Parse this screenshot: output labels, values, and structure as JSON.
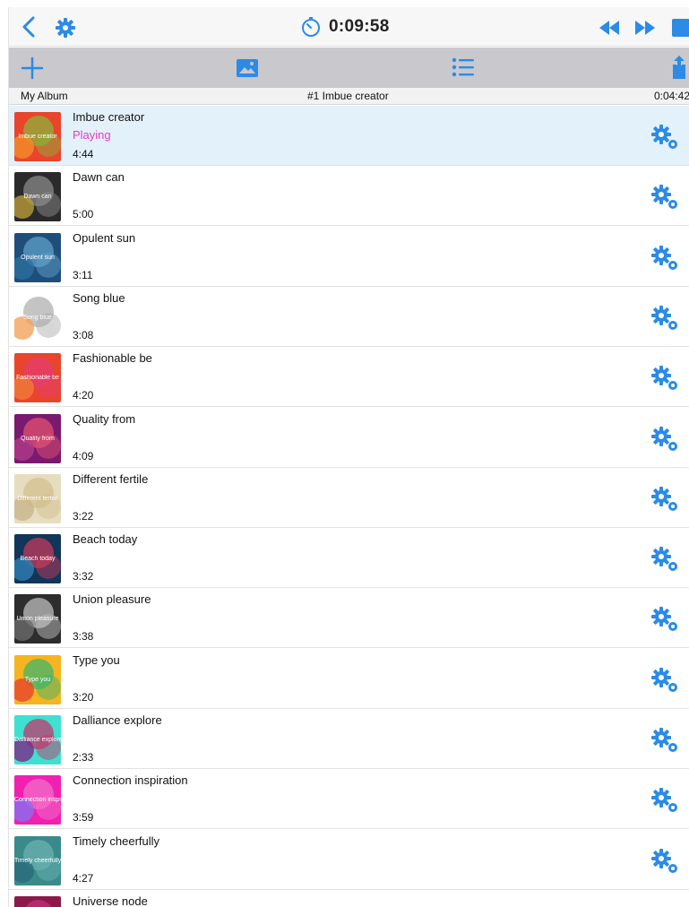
{
  "header": {
    "elapsed": "0:09:58"
  },
  "info": {
    "album": "My Album",
    "current": "#1 Imbue creator",
    "remaining": "0:04:42"
  },
  "colors": {
    "accent": "#2b8be6",
    "playing": "#e63cc5",
    "playing_row": "#e3f1fb"
  },
  "tracks": [
    {
      "title": "Imbue creator",
      "status": "Playing",
      "duration": "4:44",
      "art": "Imbue creator",
      "bg": "#e8452c",
      "c1": "#8db03a",
      "c2": "#f28c28"
    },
    {
      "title": "Dawn can",
      "status": "",
      "duration": "5:00",
      "art": "Dawn can",
      "bg": "#2a2a2a",
      "c1": "#8a8a8a",
      "c2": "#b89b3a"
    },
    {
      "title": "Opulent sun",
      "status": "",
      "duration": "3:11",
      "art": "Opulent sun",
      "bg": "#1f4e7a",
      "c1": "#5fa0c8",
      "c2": "#2c6f9e"
    },
    {
      "title": "Song blue",
      "status": "",
      "duration": "3:08",
      "art": "Song blue",
      "bg": "#ffffff",
      "c1": "#b0b0b0",
      "c2": "#f2a35c"
    },
    {
      "title": "Fashionable be",
      "status": "",
      "duration": "4:20",
      "art": "Fashionable be",
      "bg": "#e8452c",
      "c1": "#e63d6e",
      "c2": "#f07a3a"
    },
    {
      "title": "Quality from",
      "status": "",
      "duration": "4:09",
      "art": "Quality from",
      "bg": "#7a1a6e",
      "c1": "#e05070",
      "c2": "#b03a8a"
    },
    {
      "title": "Different fertile",
      "status": "",
      "duration": "3:22",
      "art": "Different fertile",
      "bg": "#e6dcc0",
      "c1": "#d2c08f",
      "c2": "#c9b58a"
    },
    {
      "title": "Beach today",
      "status": "",
      "duration": "3:32",
      "art": "Beach today",
      "bg": "#12355a",
      "c1": "#c23a5a",
      "c2": "#2e7fb0"
    },
    {
      "title": "Union pleasure",
      "status": "",
      "duration": "3:38",
      "art": "Union pleasure",
      "bg": "#2d2d2d",
      "c1": "#bdbdbd",
      "c2": "#6a6a6a"
    },
    {
      "title": "Type you",
      "status": "",
      "duration": "3:20",
      "art": "Type you",
      "bg": "#f5b520",
      "c1": "#3fb56a",
      "c2": "#e8452c"
    },
    {
      "title": "Dalliance explore",
      "status": "",
      "duration": "2:33",
      "art": "Dalliance explore",
      "bg": "#3fe0d0",
      "c1": "#c23a6e",
      "c2": "#7a2a8a"
    },
    {
      "title": "Connection inspiration",
      "status": "",
      "duration": "3:59",
      "art": "Connection inspiration",
      "bg": "#f020b0",
      "c1": "#f26ec8",
      "c2": "#8a6ef0"
    },
    {
      "title": "Timely cheerfully",
      "status": "",
      "duration": "4:27",
      "art": "Timely cheerfully",
      "bg": "#3a8a8a",
      "c1": "#6ab0b0",
      "c2": "#2a6a7a"
    },
    {
      "title": "Universe node",
      "status": "",
      "duration": "",
      "art": "",
      "bg": "#8a1a4a",
      "c1": "#c0307a",
      "c2": "#e05070"
    }
  ]
}
